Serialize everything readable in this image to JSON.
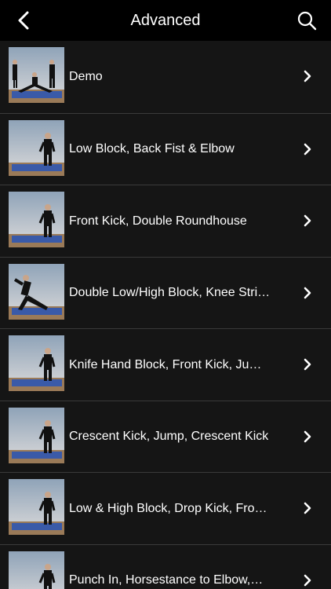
{
  "nav": {
    "title": "Advanced",
    "back_icon": "chevron-left-icon",
    "search_icon": "search-icon"
  },
  "colors": {
    "background": "#000000",
    "list_background": "#151515",
    "separator": "#3a3a3a",
    "text": "#ffffff"
  },
  "items": [
    {
      "label": "Demo",
      "thumb": "video-thumbnail"
    },
    {
      "label": "Low Block, Back Fist & Elbow",
      "thumb": "video-thumbnail"
    },
    {
      "label": "Front Kick, Double Roundhouse",
      "thumb": "video-thumbnail"
    },
    {
      "label": "Double Low/High Block, Knee Stri…",
      "thumb": "video-thumbnail"
    },
    {
      "label": "Knife Hand Block, Front Kick, Ju…",
      "thumb": "video-thumbnail"
    },
    {
      "label": "Crescent Kick, Jump, Crescent Kick",
      "thumb": "video-thumbnail"
    },
    {
      "label": "Low & High Block, Drop Kick, Fro…",
      "thumb": "video-thumbnail"
    },
    {
      "label": "Punch In, Horsestance to Elbow,…",
      "thumb": "video-thumbnail"
    }
  ]
}
